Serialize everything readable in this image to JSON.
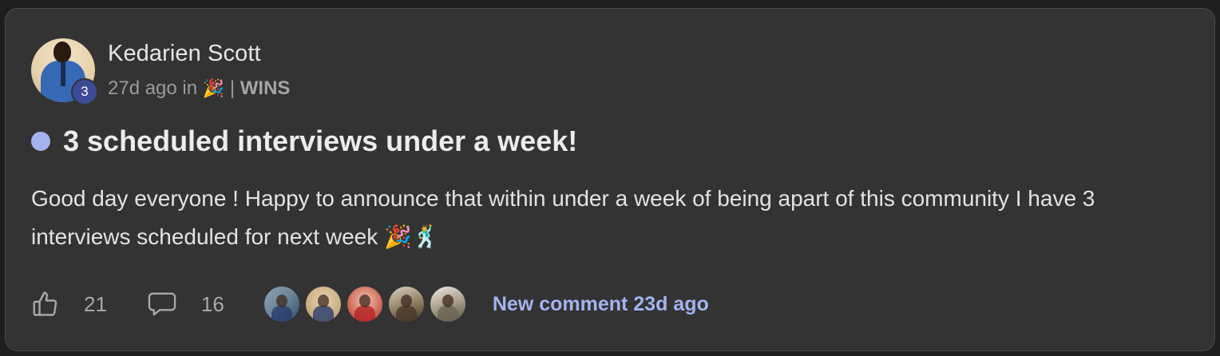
{
  "post": {
    "author": {
      "name": "Kedarien Scott",
      "level": "3"
    },
    "meta": {
      "time": "27d ago in",
      "category_icon": "🎉",
      "separator": "|",
      "category": "WINS"
    },
    "title": "3 scheduled interviews under a week!",
    "body": "Good day everyone ! Happy to announce that within under a week of being apart of this community I have 3 interviews scheduled for next week 🎉🕺",
    "likes": "21",
    "comments": "16",
    "new_comment_label": "New comment 23d ago",
    "commenter_count": 5
  },
  "icons": {
    "like": "thumbs-up-icon",
    "comment": "speech-bubble-icon",
    "unread": "unread-dot"
  },
  "colors": {
    "card_bg": "#333333",
    "accent": "#a3b3ef",
    "level_badge": "#3d4a96"
  }
}
